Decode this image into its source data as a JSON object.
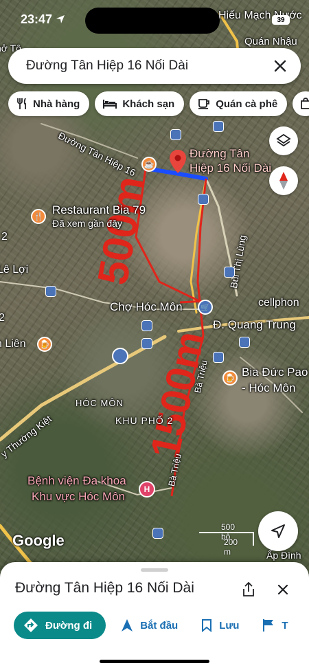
{
  "status_bar": {
    "time": "23:47",
    "battery": "39"
  },
  "search": {
    "query": "Đường Tân Hiệp 16 Nối Dài"
  },
  "chips": [
    {
      "label": "Nhà hàng",
      "icon": "fork-knife-icon"
    },
    {
      "label": "Khách sạn",
      "icon": "bed-icon"
    },
    {
      "label": "Quán cà phê",
      "icon": "coffee-cup-icon"
    }
  ],
  "map": {
    "labels": {
      "top_right": "Hiếu Mạch Nước",
      "quan_nhau": "Quán Nhậu",
      "duong_tan_hiep": "Đường Tân Hiệp 16",
      "destination_line1": "Đường Tân",
      "destination_line2": "Hiệp 16 Nối Dài",
      "restaurant": "Restaurant Bia 79",
      "restaurant_sub": "Đã xem gần đây",
      "bui_thi_lung": "Bùi Thị Lùng",
      "le_loi": "Lê Lợi",
      "cho_hoc_mon": "Chợ Hóc Môn",
      "cellphone": "cellphon",
      "quang_trung": "Đ. Quang Trung",
      "lien": "n Liên",
      "bia_duc_line1": "Bia Đức Pao",
      "bia_duc_line2": "- Hóc Môn",
      "thuong_kiet": "y Thường Kiệt",
      "hoc_mon": "HÓC MÔN",
      "khu_pho": "KHU PHỐ 2",
      "ba_trieu_1": "Bà Triệu",
      "ba_trieu_2": "Bà Triệu",
      "hospital_line1": "Bệnh viện Đa khoa",
      "hospital_line2": "Khu vực Hóc Môn",
      "ap_dinh": "Ấp Đình",
      "left_2": "2",
      "left_2b": "2",
      "tho_to": "hở Tô"
    },
    "annotations": {
      "short": "500m",
      "long": "1500m"
    },
    "scale": {
      "imperial": "500 bộ",
      "metric": "200 m"
    },
    "attribution": "Google"
  },
  "sheet": {
    "title": "Đường Tân Hiệp 16 Nối Dài",
    "actions": [
      {
        "label": "Đường đi",
        "icon": "directions-icon"
      },
      {
        "label": "Bắt đầu",
        "icon": "navigation-arrow-icon"
      },
      {
        "label": "Lưu",
        "icon": "bookmark-icon"
      },
      {
        "label": "T",
        "icon": "flag-icon"
      }
    ]
  },
  "colors": {
    "annotation_red": "#e0251b",
    "route_blue": "#1a4dff",
    "primary_teal": "#0b8a8a",
    "action_blue": "#1a6fb3"
  }
}
